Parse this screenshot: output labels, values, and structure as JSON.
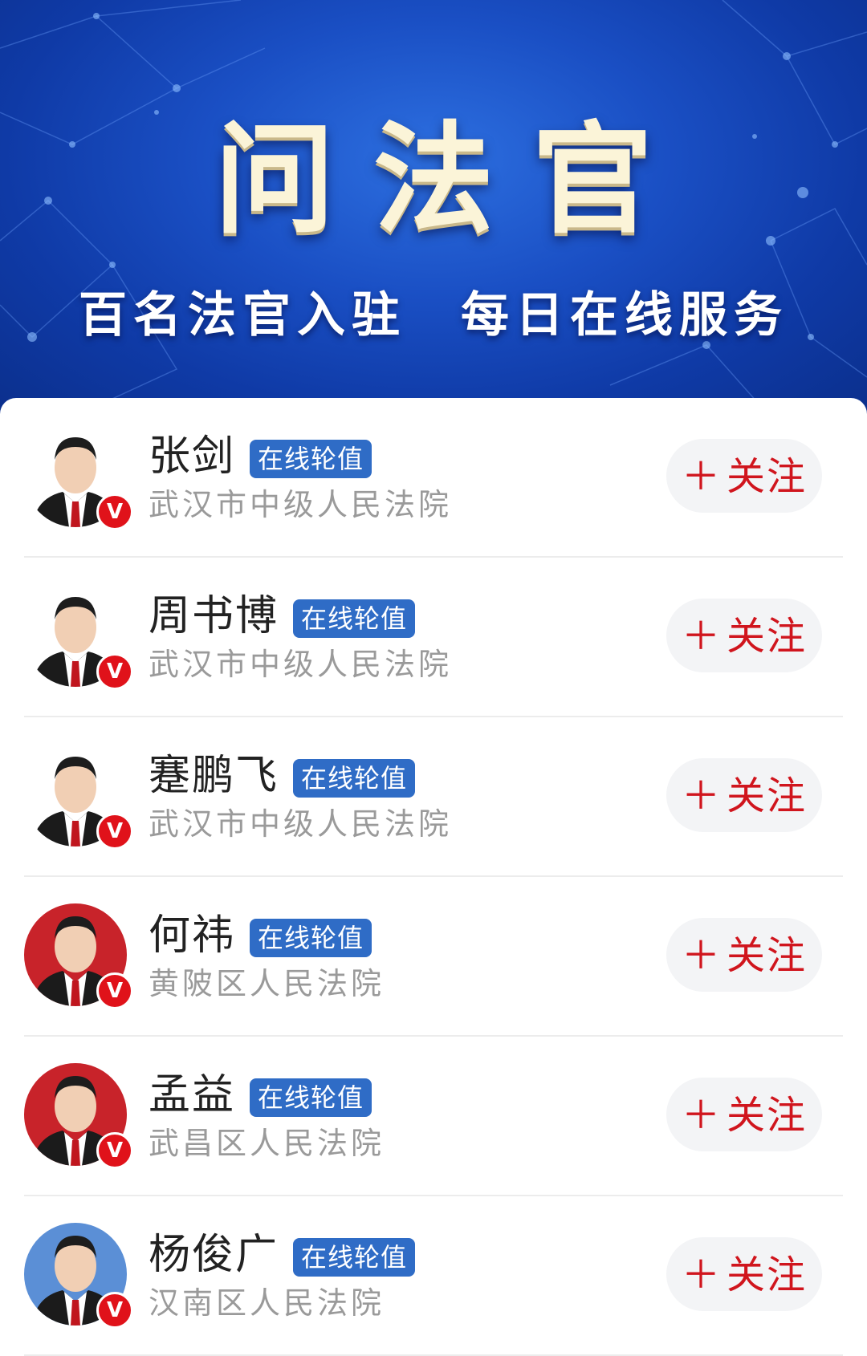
{
  "banner": {
    "title": "问法官",
    "subtitle": "百名法官入驻　每日在线服务"
  },
  "colors": {
    "banner_blue": "#1a4fc4",
    "badge_blue": "#2f6cc6",
    "follow_red": "#d0151d",
    "verified_red": "#e0121a"
  },
  "judges": [
    {
      "name": "张剑",
      "badge": "在线轮值",
      "court": "武汉市中级人民法院",
      "follow": "关注",
      "follow_icon": "plus-icon",
      "verified": "V",
      "avatar_bg": "#ffffff"
    },
    {
      "name": "周书博",
      "badge": "在线轮值",
      "court": "武汉市中级人民法院",
      "follow": "关注",
      "follow_icon": "plus-icon",
      "verified": "V",
      "avatar_bg": "#ffffff"
    },
    {
      "name": "蹇鹏飞",
      "badge": "在线轮值",
      "court": "武汉市中级人民法院",
      "follow": "关注",
      "follow_icon": "plus-icon",
      "verified": "V",
      "avatar_bg": "#ffffff"
    },
    {
      "name": "何祎",
      "badge": "在线轮值",
      "court": "黄陂区人民法院",
      "follow": "关注",
      "follow_icon": "plus-icon",
      "verified": "V",
      "avatar_bg": "#c8232a"
    },
    {
      "name": "孟益",
      "badge": "在线轮值",
      "court": "武昌区人民法院",
      "follow": "关注",
      "follow_icon": "plus-icon",
      "verified": "V",
      "avatar_bg": "#c8232a"
    },
    {
      "name": "杨俊广",
      "badge": "在线轮值",
      "court": "汉南区人民法院",
      "follow": "关注",
      "follow_icon": "plus-icon",
      "verified": "V",
      "avatar_bg": "#5b8fd6"
    }
  ]
}
